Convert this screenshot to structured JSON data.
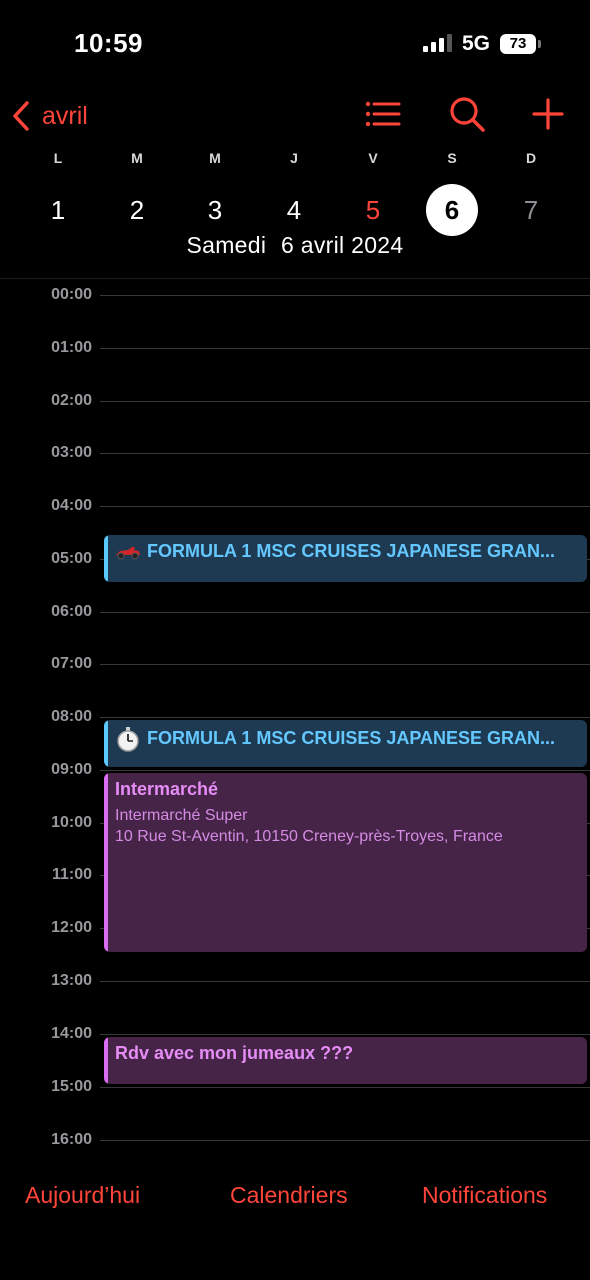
{
  "status": {
    "time": "10:59",
    "network": "5G",
    "battery": "73"
  },
  "nav": {
    "back_label": "avril",
    "icons": [
      "list-icon",
      "search-icon",
      "plus-icon"
    ]
  },
  "week": {
    "weekdays": [
      "L",
      "M",
      "M",
      "J",
      "V",
      "S",
      "D"
    ],
    "days": [
      "1",
      "2",
      "3",
      "4",
      "5",
      "6",
      "7"
    ],
    "selected": "6",
    "accent": "#ff453a"
  },
  "date_title": {
    "weekday": "Samedi",
    "date": "6 avril 2024"
  },
  "hours": [
    "00:00",
    "01:00",
    "02:00",
    "03:00",
    "04:00",
    "05:00",
    "06:00",
    "07:00",
    "08:00",
    "09:00",
    "10:00",
    "11:00",
    "12:00",
    "13:00",
    "14:00",
    "15:00",
    "16:00"
  ],
  "events": [
    {
      "title": "FORMULA 1 MSC CRUISES JAPANESE GRAN...",
      "icon": "race-car-icon",
      "color": "#5ac8fa"
    },
    {
      "title": "FORMULA 1 MSC CRUISES JAPANESE GRAN...",
      "icon": "stopwatch-icon",
      "color": "#5ac8fa"
    },
    {
      "title": "Intermarché",
      "line1": "Intermarché Super",
      "line2": "10 Rue St-Aventin, 10150 Creney-près-Troyes, France",
      "color": "#d96cf0"
    },
    {
      "title": "Rdv avec mon jumeaux ???",
      "color": "#d96cf0"
    }
  ],
  "tabbar": {
    "today": "Aujourd’hui",
    "calendars": "Calendriers",
    "notifications": "Notifications"
  }
}
